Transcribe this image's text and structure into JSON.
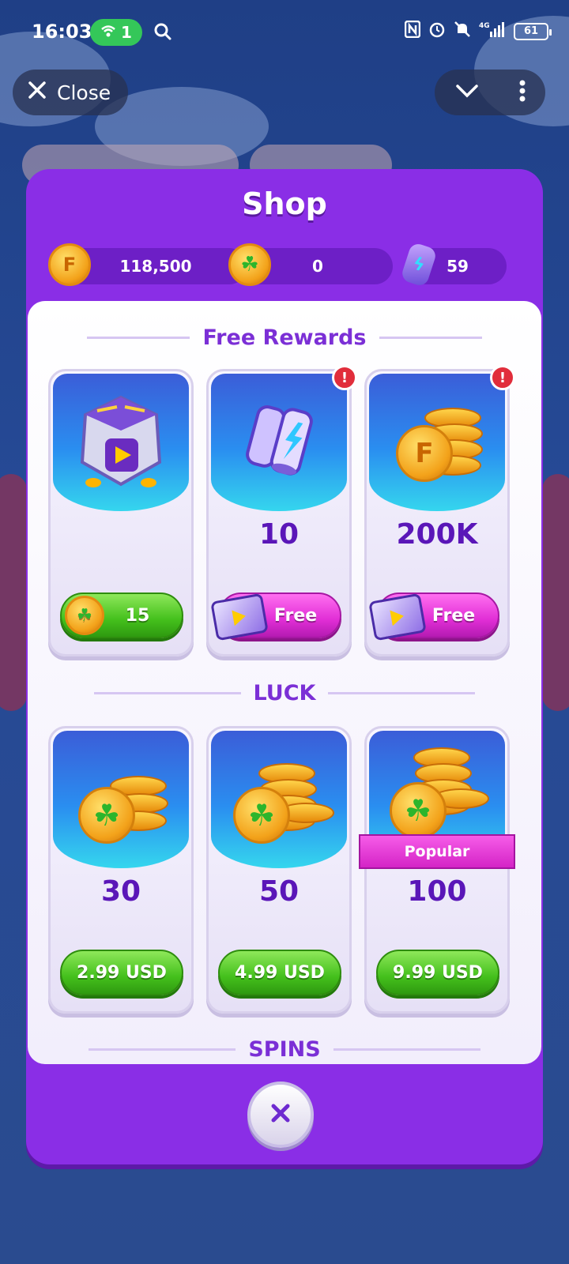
{
  "status_bar": {
    "time": "16:03",
    "wifi_count": "1",
    "battery": "61",
    "network": "4G"
  },
  "top_bar": {
    "close_label": "Close"
  },
  "shop": {
    "title": "Shop",
    "currencies": [
      {
        "icon": "gold-coin-icon",
        "value": "118,500"
      },
      {
        "icon": "clover-coin-icon",
        "value": "0"
      },
      {
        "icon": "energy-battery-icon",
        "value": "59"
      }
    ],
    "sections": {
      "free_rewards": "Free Rewards",
      "luck": "LUCK",
      "spins": "SPINS"
    },
    "free_cards": [
      {
        "amount": "",
        "button": "15",
        "button_type": "clover-coin",
        "alert": false
      },
      {
        "amount": "10",
        "button": "Free",
        "button_type": "video",
        "alert": true
      },
      {
        "amount": "200K",
        "button": "Free",
        "button_type": "video",
        "alert": true
      }
    ],
    "luck_cards": [
      {
        "amount": "30",
        "price": "2.99 USD"
      },
      {
        "amount": "50",
        "price": "4.99 USD"
      },
      {
        "amount": "100",
        "price": "9.99 USD",
        "badge": "Popular"
      }
    ],
    "alert_mark": "!",
    "coin_letter": "F"
  },
  "colors": {
    "modal": "#8a2ee6",
    "accent_text": "#7b2fd6",
    "green_button": "#44c01c",
    "pink_button": "#e12ed6"
  }
}
